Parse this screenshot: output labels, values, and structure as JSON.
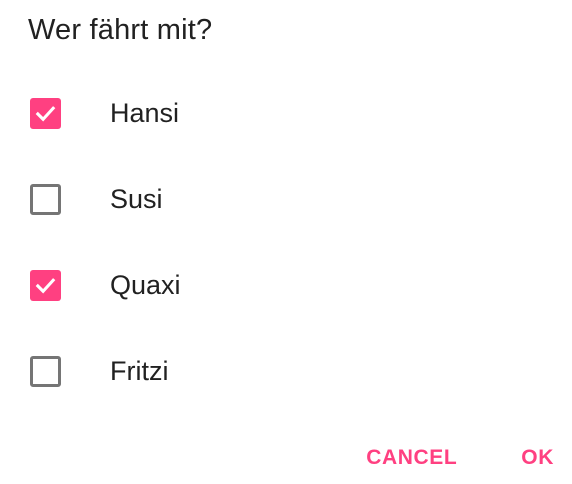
{
  "dialog": {
    "title": "Wer fährt mit?",
    "accent_color": "#ff4081",
    "options": [
      {
        "label": "Hansi",
        "checked": true
      },
      {
        "label": "Susi",
        "checked": false
      },
      {
        "label": "Quaxi",
        "checked": true
      },
      {
        "label": "Fritzi",
        "checked": false
      }
    ],
    "actions": {
      "cancel_label": "CANCEL",
      "ok_label": "OK"
    }
  }
}
